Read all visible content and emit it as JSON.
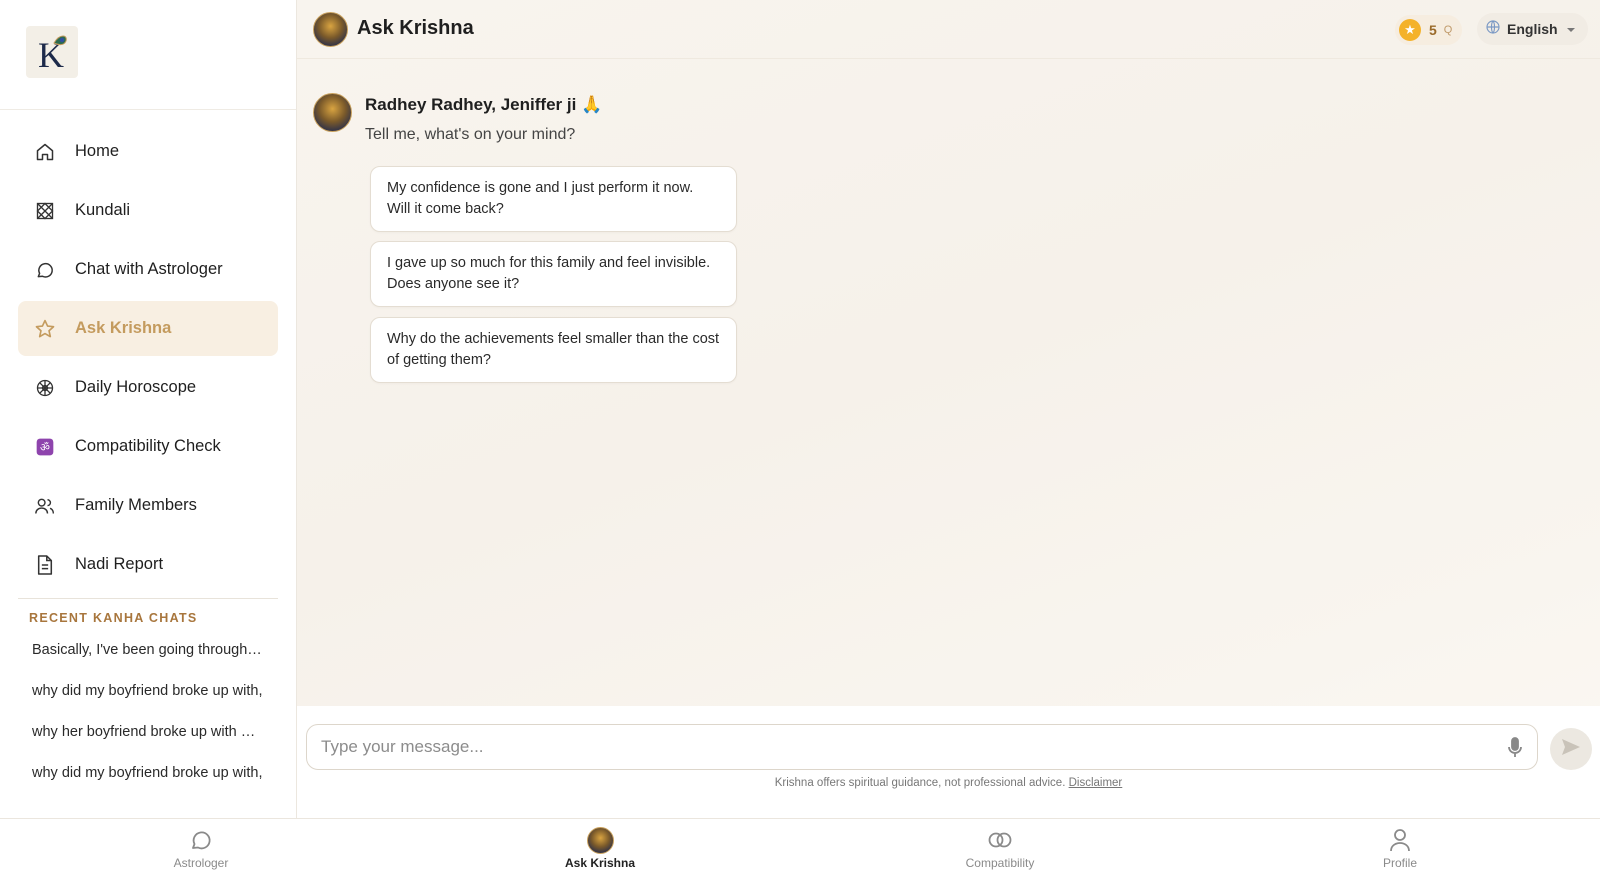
{
  "sidebar": {
    "nav": [
      {
        "label": "Home",
        "icon": "home-icon"
      },
      {
        "label": "Kundali",
        "icon": "kundali-grid-icon"
      },
      {
        "label": "Chat with Astrologer",
        "icon": "chat-bubble-icon"
      },
      {
        "label": "Ask Krishna",
        "icon": "star-icon",
        "active": true
      },
      {
        "label": "Daily Horoscope",
        "icon": "zodiac-wheel-icon"
      },
      {
        "label": "Compatibility Check",
        "icon": "om-icon"
      },
      {
        "label": "Family Members",
        "icon": "people-icon"
      },
      {
        "label": "Nadi Report",
        "icon": "document-icon"
      }
    ],
    "recent_title": "RECENT KANHA CHATS",
    "recent": [
      "Basically, I've been going through…",
      "why did my boyfriend broke up with,",
      "why her boyfriend broke up with …",
      "why did my boyfriend broke up with,"
    ]
  },
  "header": {
    "title": "Ask Krishna",
    "coins": "5",
    "coins_suffix": "Q",
    "language": "English"
  },
  "chat": {
    "greeting": "Radhey Radhey, Jeniffer ji 🙏",
    "prompt": "Tell me, what's on your mind?",
    "suggestions": [
      "My confidence is gone and I just perform it now. Will it come back?",
      "I gave up so much for this family and feel invisible. Does anyone see it?",
      "Why do the achievements feel smaller than the cost of getting them?"
    ]
  },
  "composer": {
    "placeholder": "Type your message...",
    "disclaimer_text": "Krishna offers spiritual guidance, not professional advice.",
    "disclaimer_link": "Disclaimer"
  },
  "bottom_nav": [
    {
      "label": "Astrologer",
      "icon": "chat-bubble-icon"
    },
    {
      "label": "Ask Krishna",
      "icon": "krishna-avatar-icon",
      "active": true
    },
    {
      "label": "Compatibility",
      "icon": "rings-icon"
    },
    {
      "label": "Profile",
      "icon": "person-icon"
    }
  ],
  "colors": {
    "accent": "#c49b5e",
    "active_bg": "#f8efe2",
    "coin": "#f4b22a"
  }
}
